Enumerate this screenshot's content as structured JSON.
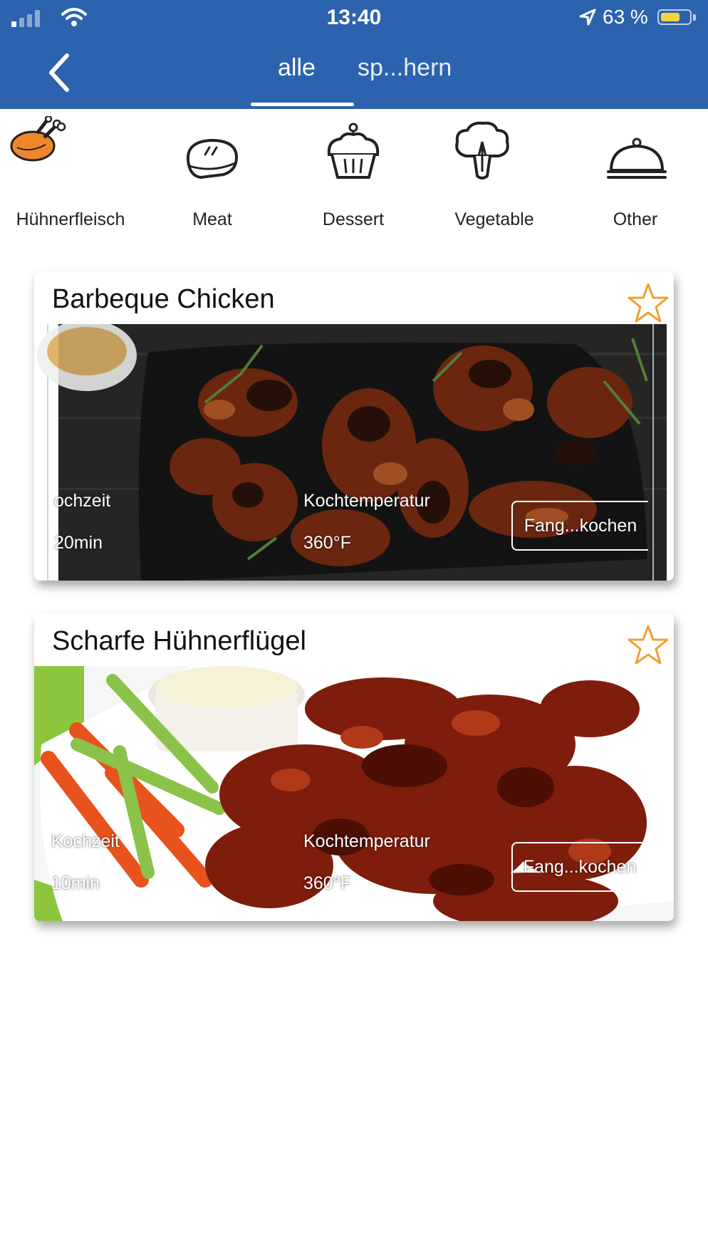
{
  "status_bar": {
    "time": "13:40",
    "battery": "63 %"
  },
  "nav": {
    "tabs": [
      {
        "label": "alle"
      },
      {
        "label": "sp...hern"
      }
    ]
  },
  "categories": [
    {
      "label": "Hühnerfleisch",
      "icon": "chicken-icon"
    },
    {
      "label": "Meat",
      "icon": "steak-icon"
    },
    {
      "label": "Dessert",
      "icon": "cupcake-icon"
    },
    {
      "label": "Vegetable",
      "icon": "broccoli-icon"
    },
    {
      "label": "Other",
      "icon": "cloche-icon"
    }
  ],
  "recipes": [
    {
      "title": "Barbeque Chicken",
      "time_label": "ochzeit",
      "time_value": "20min",
      "temp_label": "Kochtemperatur",
      "temp_value": "360°F",
      "button": "Fang...kochen"
    },
    {
      "title": "Scharfe Hühnerflügel",
      "time_label": "Kochzeit",
      "time_value": "10min",
      "temp_label": "Kochtemperatur",
      "temp_value": "360°F",
      "button": "Fang...kochen"
    }
  ],
  "colors": {
    "header": "#2b63ae",
    "accent_star": "#f0a030",
    "chicken_icon": "#f0862a"
  }
}
